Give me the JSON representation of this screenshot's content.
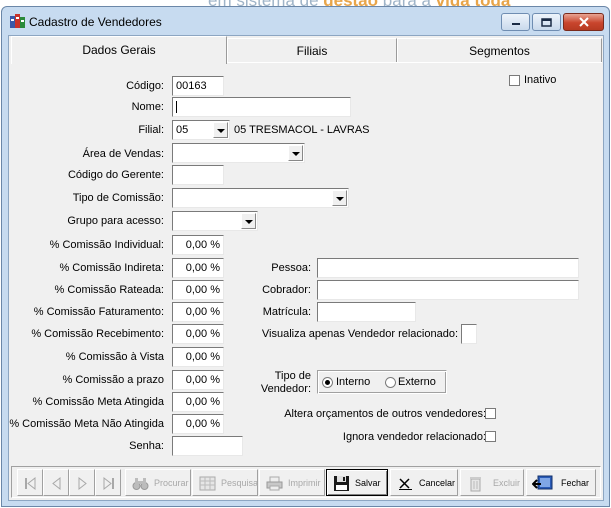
{
  "background": {
    "text_left": "em sistema de ",
    "text_bold1": "gestão",
    "text_mid": " para a ",
    "text_bold2": "vida toda"
  },
  "window": {
    "title": "Cadastro de Vendedores"
  },
  "tabs": [
    {
      "label": "Dados Gerais",
      "active": true
    },
    {
      "label": "Filiais",
      "active": false
    },
    {
      "label": "Segmentos",
      "active": false
    }
  ],
  "form": {
    "codigo_label": "Código:",
    "codigo_value": "00163",
    "inativo_label": "Inativo",
    "nome_label": "Nome:",
    "nome_value": "",
    "filial_label": "Filial:",
    "filial_value": "05",
    "filial_desc": "05 TRESMACOL - LAVRAS",
    "area_label": "Área de Vendas:",
    "area_value": "",
    "gerente_label": "Código do Gerente:",
    "gerente_value": "",
    "tipo_comissao_label": "Tipo de Comissão:",
    "tipo_comissao_value": "",
    "grupo_label": "Grupo para acesso:",
    "grupo_value": "",
    "com_individual_label": "% Comissão Individual:",
    "com_individual_value": "0,00 %",
    "com_indireta_label": "% Comissão Indireta:",
    "com_indireta_value": "0,00 %",
    "com_rateada_label": "% Comissão Rateada:",
    "com_rateada_value": "0,00 %",
    "com_faturamento_label": "% Comissão Faturamento:",
    "com_faturamento_value": "0,00 %",
    "com_recebimento_label": "% Comissão Recebimento:",
    "com_recebimento_value": "0,00 %",
    "com_vista_label": "% Comissão à Vista",
    "com_vista_value": "0,00 %",
    "com_prazo_label": "% Comissão a prazo",
    "com_prazo_value": "0,00 %",
    "com_meta_label": "% Comissão Meta Atingida",
    "com_meta_value": "0,00 %",
    "com_nao_meta_label": "% Comissão Meta Não Atingida",
    "com_nao_meta_value": "0,00 %",
    "senha_label": "Senha:",
    "senha_value": "",
    "pessoa_label": "Pessoa:",
    "pessoa_value": "",
    "cobrador_label": "Cobrador:",
    "cobrador_value": "",
    "matricula_label": "Matrícula:",
    "matricula_value": "",
    "visualiza_label": "Visualiza apenas Vendedor  relacionado:",
    "tipo_vendedor_label_1": "Tipo de",
    "tipo_vendedor_label_2": "Vendedor:",
    "interno_label": "Interno",
    "externo_label": "Externo",
    "tipo_vendedor_selected": "Interno",
    "altera_label": "Altera orçamentos de outros vendedores:",
    "ignora_label": "Ignora vendedor relacionado:"
  },
  "toolbar": {
    "procurar": "Procurar",
    "pesquisa": "Pesquisa",
    "imprimir": "Imprimir",
    "salvar": "Salvar",
    "cancelar": "Cancelar",
    "excluir": "Excluir",
    "fechar": "Fechar"
  }
}
